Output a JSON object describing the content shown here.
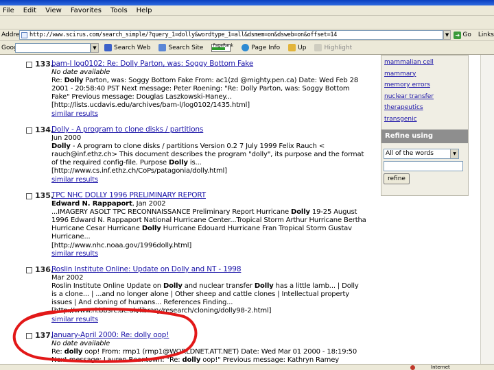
{
  "window": {
    "title": ""
  },
  "menu": [
    "File",
    "Edit",
    "View",
    "Favorites",
    "Tools",
    "Help"
  ],
  "address": {
    "label": "Address",
    "url": "http://www.scirus.com/search_simple/?query_1=dolly&wordtype_1=all&dsmem=on&dsweb=on&offset=14",
    "go_label": "Go",
    "links_label": "Links"
  },
  "googlebar": {
    "label": "Google",
    "search_web": "Search Web",
    "search_site": "Search Site",
    "pagerank_label": "PageRank",
    "pagerank_fraction": 0.7,
    "page_info": "Page Info",
    "up": "Up",
    "highlight": "Highlight"
  },
  "results": [
    {
      "num": "133.",
      "title": "bam-l log0102: Re: Dolly Parton, was: Soggy Bottom Fake",
      "lines": [
        [
          {
            "t": "No date available",
            "s": "ital"
          }
        ],
        [
          {
            "t": "Re: "
          },
          {
            "t": "Dolly",
            "s": "bold"
          },
          {
            "t": " Parton, was: Soggy Bottom Fake From: ac1(zd @mighty.pen.ca) Date: Wed Feb 28"
          }
        ],
        [
          {
            "t": "2001 - 20:58:40 PST Next message: Peter Roening: \"Re: Dolly Parton, was: Soggy Bottom"
          }
        ],
        [
          {
            "t": "Fake\" Previous message: Douglas Laszkowski-Haney..."
          }
        ],
        [
          {
            "t": "[http://lists.ucdavis.edu/archives/bam-l/log0102/1435.html]"
          }
        ]
      ],
      "similar": "similar results"
    },
    {
      "num": "134.",
      "title": "Dolly - A program to clone disks / partitions",
      "lines": [
        [
          {
            "t": "Jun 2000"
          }
        ],
        [
          {
            "t": "Dolly",
            "s": "bold"
          },
          {
            "t": " - A program to clone disks / partitions Version 0.2 7 July 1999 Felix Rauch <"
          }
        ],
        [
          {
            "t": "rauch@inf.ethz.ch> This document describes the program \"dolly\", its purpose and the format"
          }
        ],
        [
          {
            "t": "of the required config-file. Purpose "
          },
          {
            "t": "Dolly",
            "s": "bold"
          },
          {
            "t": " is..."
          }
        ],
        [
          {
            "t": "[http://www.cs.inf.ethz.ch/CoPs/patagonia/dolly.html]"
          }
        ]
      ],
      "similar": "similar results"
    },
    {
      "num": "135.",
      "title": "TPC NHC DOLLY 1996 PRELIMINARY REPORT",
      "lines": [
        [
          {
            "t": "Edward N. Rappaport",
            "s": "bold"
          },
          {
            "t": ", Jan 2002"
          }
        ],
        [
          {
            "t": "...IMAGERY ASOLT TPC RECONNAISSANCE Preliminary Report Hurricane "
          },
          {
            "t": "Dolly",
            "s": "bold"
          },
          {
            "t": " 19-25 August"
          }
        ],
        [
          {
            "t": "1996 Edward N. Rappaport National Hurricane Center...Tropical Storm Arthur Hurricane Bertha"
          }
        ],
        [
          {
            "t": "Hurricane Cesar Hurricane "
          },
          {
            "t": "Dolly",
            "s": "bold"
          },
          {
            "t": " Hurricane Edouard Hurricane Fran Tropical Storm Gustav"
          }
        ],
        [
          {
            "t": "Hurricane..."
          }
        ],
        [
          {
            "t": "[http://www.nhc.noaa.gov/1996dolly.html]"
          }
        ]
      ],
      "similar": "similar results"
    },
    {
      "num": "136.",
      "title": "Roslin Institute Online: Update on Dolly and NT - 1998",
      "lines": [
        [
          {
            "t": "Mar 2002"
          }
        ],
        [
          {
            "t": "Roslin Institute Online Update on "
          },
          {
            "t": "Dolly",
            "s": "bold"
          },
          {
            "t": " and nuclear transfer "
          },
          {
            "t": "Dolly",
            "s": "bold"
          },
          {
            "t": " has a little lamb... | Dolly"
          }
        ],
        [
          {
            "t": "is a clone... | ...and no longer alone | Other sheep and cattle clones | Intellectual property"
          }
        ],
        [
          {
            "t": "issues | And cloning of humans... References Finding..."
          }
        ],
        [
          {
            "t": "[http://www.ri.bbsrc.ac.uk/library/research/cloning/dolly98-2.html]"
          }
        ]
      ],
      "similar": "similar results"
    },
    {
      "num": "137.",
      "title": "January-April 2000: Re: dolly oop!",
      "lines": [
        [
          {
            "t": "No date available",
            "s": "ital"
          }
        ],
        [
          {
            "t": "Re: "
          },
          {
            "t": "dolly",
            "s": "bold"
          },
          {
            "t": " oop! From: rmp1 (rmp1@WORLDNET.ATT.NET) Date: Wed Mar 01 2000 - 18:19:50"
          }
        ],
        [
          {
            "t": "Next message: Lauren Beantown: \"Re: "
          },
          {
            "t": "dolly",
            "s": "bold"
          },
          {
            "t": " oop!\" Previous message: Kathryn Ramey"
          }
        ]
      ],
      "similar": ""
    }
  ],
  "sidebar": {
    "links": [
      "mammalian cell",
      "mammary",
      "memory errors",
      "nuclear transfer",
      "therapeutics",
      "transgenic"
    ],
    "refine_heading": "Refine using",
    "refine_select_value": "All of the words",
    "refine_input_value": "",
    "refine_button": "refine"
  },
  "status": {
    "zone": "Internet"
  },
  "colors": {
    "link": "#1a13a8",
    "annotation": "#e21818",
    "refine_header": "#8e8e8e",
    "chrome": "#ece9d8"
  }
}
